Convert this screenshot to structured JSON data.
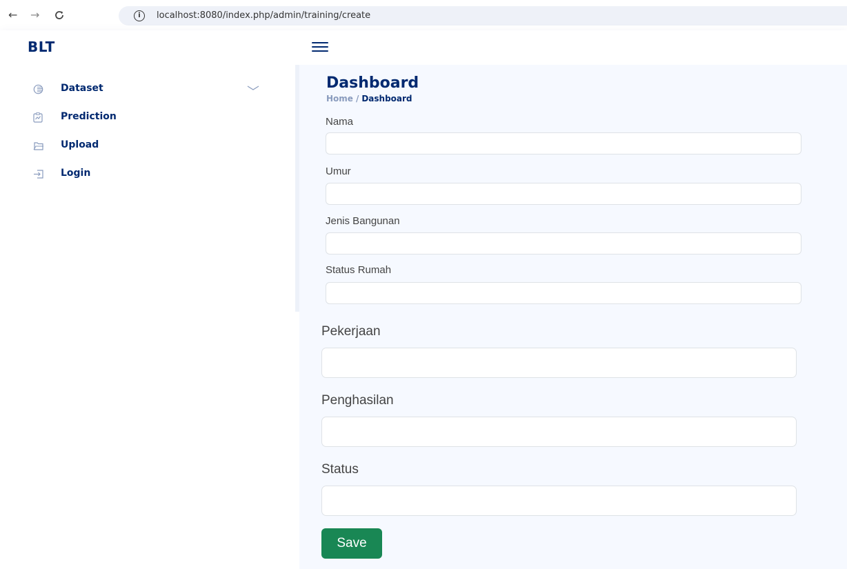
{
  "browser": {
    "back_icon": "←",
    "forward_icon": "→",
    "reload_icon": "C",
    "info_icon": "i",
    "url": "localhost:8080/index.php/admin/training/create"
  },
  "header": {
    "logo": "BLT",
    "menu_icon": "hamburger-menu-icon"
  },
  "sidebar": {
    "items": [
      {
        "label": "Dataset",
        "icon": "database-icon",
        "expandable": true
      },
      {
        "label": "Prediction",
        "icon": "chart-icon"
      },
      {
        "label": "Upload",
        "icon": "upload-icon"
      },
      {
        "label": "Login",
        "icon": "login-icon"
      }
    ]
  },
  "main": {
    "title": "Dashboard",
    "breadcrumb": {
      "home": "Home",
      "separator": "/",
      "current": "Dashboard"
    },
    "fields": [
      {
        "label": "Nama",
        "value": ""
      },
      {
        "label": "Umur",
        "value": ""
      },
      {
        "label": "Jenis Bangunan",
        "value": ""
      },
      {
        "label": "Status Rumah",
        "value": ""
      },
      {
        "label": "Pekerjaan",
        "value": ""
      },
      {
        "label": "Penghasilan",
        "value": ""
      },
      {
        "label": "Status",
        "value": ""
      }
    ],
    "save_label": "Save"
  },
  "colors": {
    "brand": "#012970",
    "muted": "#899bbd",
    "save": "#198754",
    "main_bg": "#f6f9ff"
  }
}
